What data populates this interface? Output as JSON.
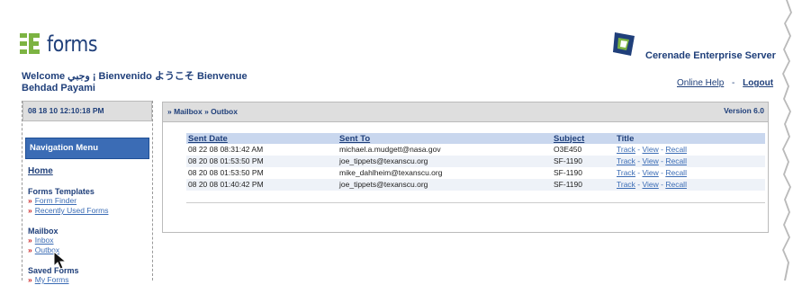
{
  "app": {
    "logo_text": "forms",
    "server_name": "Cerenade Enterprise Server",
    "welcome": "Welcome وجبي ¡ Bienvenido ようこそ Bienvenue Behdad Payami",
    "links": {
      "online_help": "Online Help",
      "separator": "-",
      "logout": "Logout"
    }
  },
  "sidebar": {
    "datetime": "08 18 10 12:10:18 PM",
    "nav_title": "Navigation Menu",
    "home": "Home",
    "sections": [
      {
        "title": "Forms Templates",
        "items": [
          "Form Finder",
          "Recently Used Forms"
        ]
      },
      {
        "title": "Mailbox",
        "items": [
          "Inbox",
          "Outbox"
        ]
      },
      {
        "title": "Saved Forms",
        "items": [
          "My Forms"
        ]
      }
    ]
  },
  "main": {
    "breadcrumb": "» Mailbox » Outbox",
    "version": "Version 6.0",
    "columns": [
      "Sent Date",
      "Sent To",
      "Subject",
      "Title"
    ],
    "rows": [
      {
        "date": "08 22 08 08:31:42 AM",
        "to": "michael.a.mudgett@nasa.gov",
        "subject": "O3E450"
      },
      {
        "date": "08 20 08 01:53:50 PM",
        "to": "joe_tippets@texanscu.org",
        "subject": "SF-1190"
      },
      {
        "date": "08 20 08 01:53:50 PM",
        "to": "mike_dahlheim@texanscu.org",
        "subject": "SF-1190"
      },
      {
        "date": "08 20 08 01:40:42 PM",
        "to": "joe_tippets@texanscu.org",
        "subject": "SF-1190"
      }
    ],
    "actions": {
      "track": "Track",
      "view": "View",
      "recall": "Recall",
      "sep": " - "
    }
  },
  "colors": {
    "brand": "#1f3f7a",
    "accent": "#3b6cb5",
    "nav_header": "#3b6cb5",
    "row_alt": "#eef2f8",
    "header_bg": "#c9d7ee",
    "bullet": "#cc2222"
  },
  "icons": {
    "logo": "e-forms-icon",
    "brand": "cerenade-logo-icon",
    "cursor": "hand-pointer-icon",
    "bullet": "double-chevron-icon"
  }
}
